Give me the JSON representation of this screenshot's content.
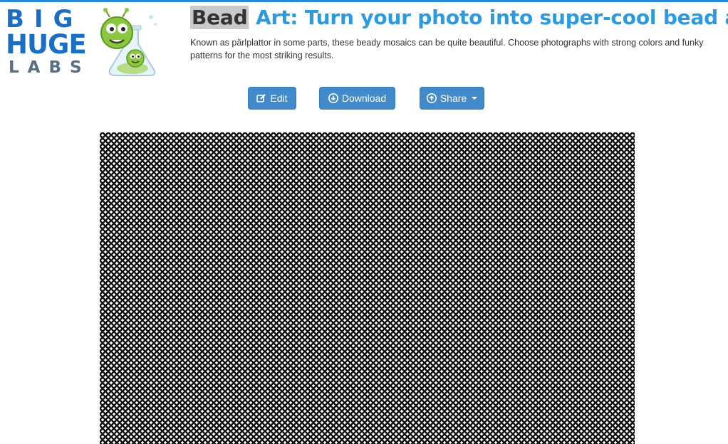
{
  "logo": {
    "line1": "BIG",
    "line2": "HUGE",
    "line3": "LABS"
  },
  "header": {
    "title_highlight": "Bead",
    "title_rest": " Art: Turn your photo into super-cool bead art.",
    "description": "Known as pärlplattor in some parts, these beady mosaics can be quite beautiful. Choose photographs with strong colors and funky patterns for the most striking results."
  },
  "toolbar": {
    "edit_label": "Edit",
    "download_label": "Download",
    "share_label": "Share"
  },
  "colors": {
    "accent": "#2b9be0",
    "button": "#428bca",
    "bead_hole": "#ffffff",
    "pegboard": "#000000",
    "skin": "#b57f6e",
    "skin_shadow": "#7a4434",
    "grey": "#9a9a9a",
    "dark": "#333333"
  },
  "icons": {
    "edit": "edit-icon",
    "download": "download-circle-icon",
    "share": "share-circle-icon"
  }
}
